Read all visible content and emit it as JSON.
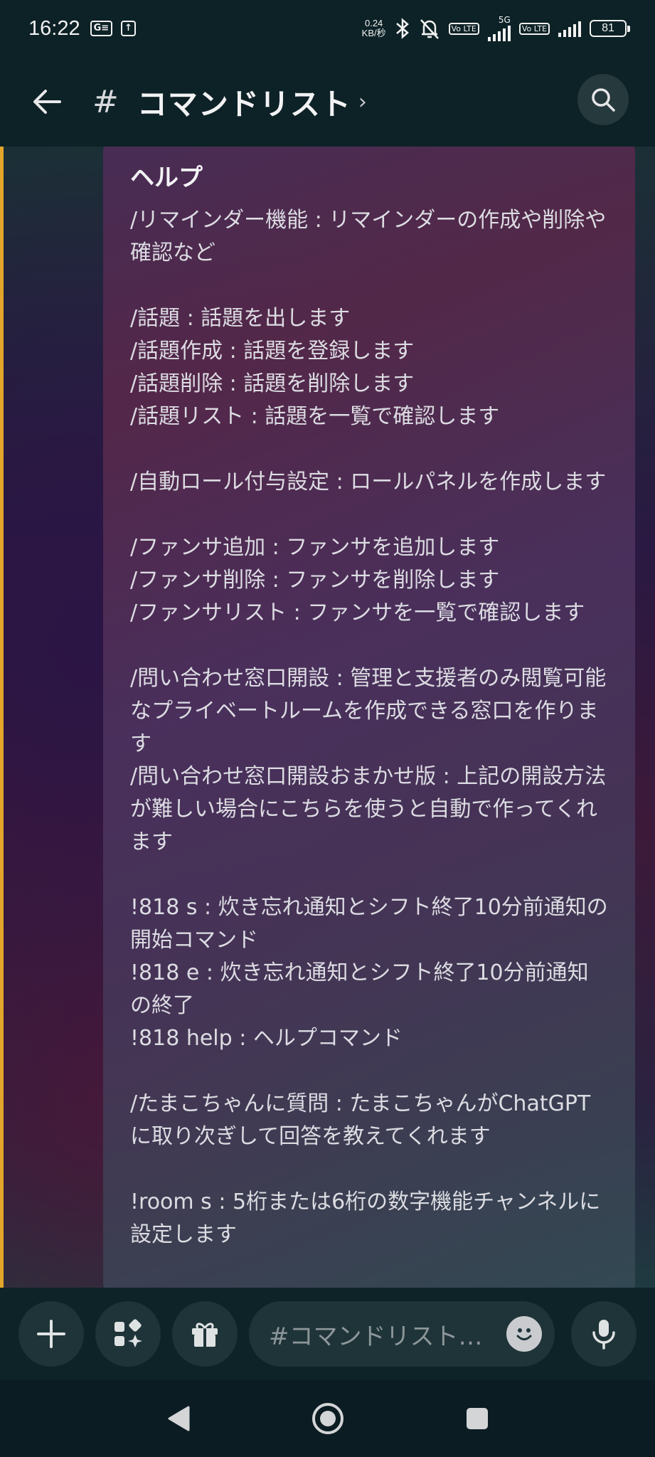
{
  "status_bar": {
    "time": "16:22",
    "net_speed_value": "0.24",
    "net_speed_unit": "KB/秒",
    "network_gen": "5G",
    "volte_label_1": "Vo LTE",
    "volte_label_2": "Vo LTE",
    "battery": "81",
    "icons": [
      "notification-ge-icon",
      "upload-icon",
      "bluetooth-icon",
      "mute-bell-icon",
      "signal-icon",
      "battery-icon"
    ]
  },
  "header": {
    "hash": "#",
    "title": "コマンドリスト",
    "chevron": "›"
  },
  "embed": {
    "title": "ヘルプ",
    "blocks": [
      [
        "/リマインダー機能 : リマインダーの作成や削除や確認など"
      ],
      [
        "/話題 : 話題を出します",
        "/話題作成 : 話題を登録します",
        "/話題削除 : 話題を削除します",
        "/話題リスト : 話題を一覧で確認します"
      ],
      [
        "/自動ロール付与設定 : ロールパネルを作成します"
      ],
      [
        "/ファンサ追加 : ファンサを追加します",
        "/ファンサ削除 : ファンサを削除します",
        "/ファンサリスト : ファンサを一覧で確認します"
      ],
      [
        "/問い合わせ窓口開設 : 管理と支援者のみ閲覧可能なプライベートルームを作成できる窓口を作ります",
        "/問い合わせ窓口開設おまかせ版 : 上記の開設方法が難しい場合にこちらを使うと自動で作ってくれます"
      ],
      [
        "!818 s : 炊き忘れ通知とシフト終了10分前通知の開始コマンド",
        "!818 e : 炊き忘れ通知とシフト終了10分前通知の終了",
        "!818 help : ヘルプコマンド"
      ],
      [
        "/たまこちゃんに質問 : たまこちゃんがChatGPTに取り次ぎして回答を教えてくれます"
      ],
      [
        "!room s : 5桁または6桁の数字機能チャンネルに設定します"
      ]
    ]
  },
  "composer": {
    "placeholder": "#コマンドリスト…"
  },
  "colors": {
    "mention_bar": "#e3a52a",
    "header_bg": "#0d2226",
    "composer_bg": "#0e2327"
  }
}
